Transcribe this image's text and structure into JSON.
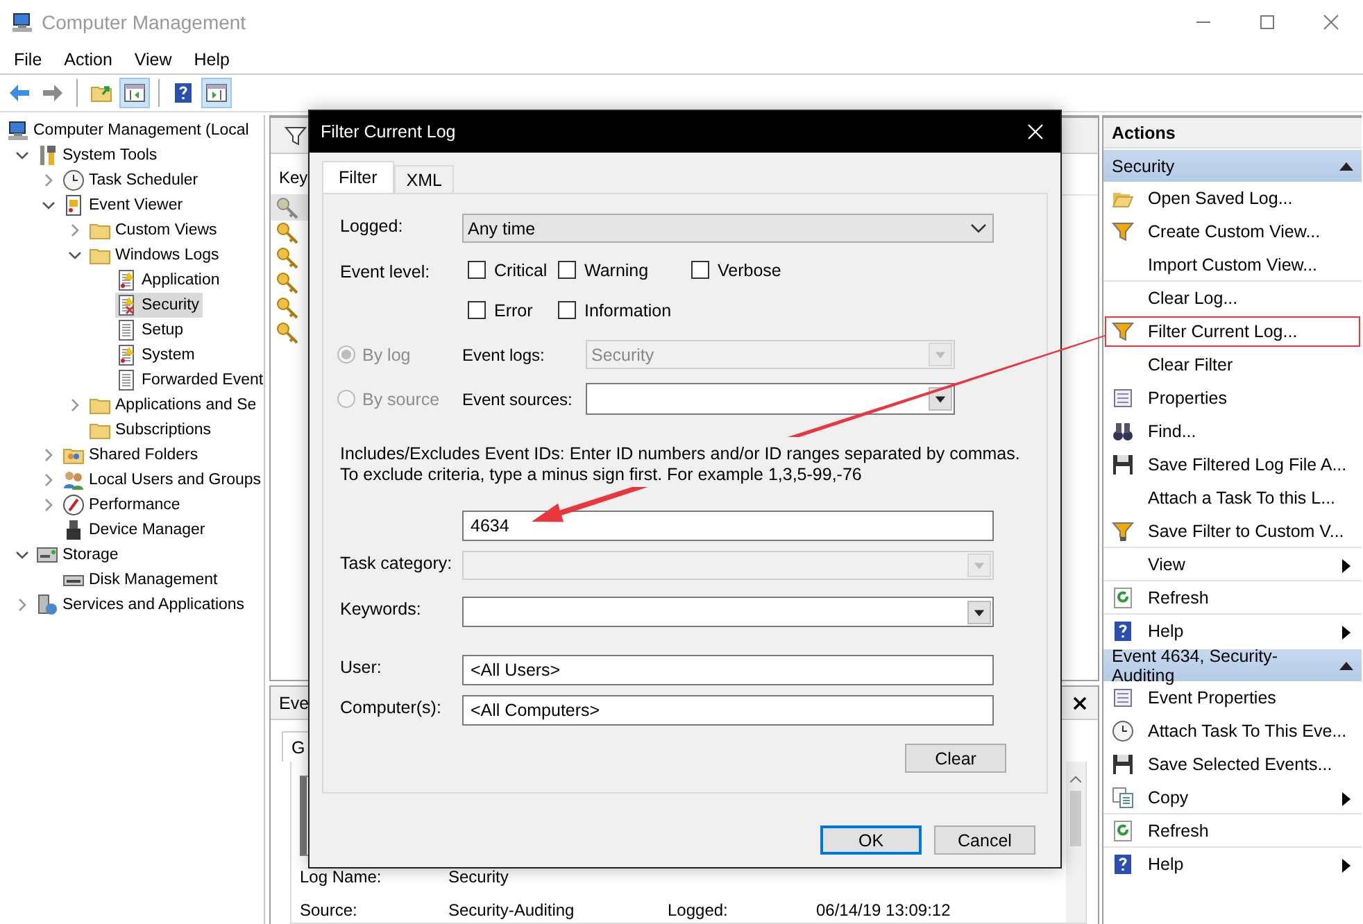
{
  "window": {
    "title": "Computer Management"
  },
  "menu": [
    "File",
    "Action",
    "View",
    "Help"
  ],
  "toolbar": [
    [
      {
        "kind": "back",
        "pressed": false
      },
      {
        "kind": "forward",
        "pressed": false
      }
    ],
    [
      {
        "kind": "up",
        "pressed": false
      },
      {
        "kind": "pane",
        "pressed": true
      }
    ],
    [
      {
        "kind": "help",
        "pressed": false
      },
      {
        "kind": "actionpane",
        "pressed": true
      }
    ]
  ],
  "tree": [
    {
      "label": "Computer Management (Local",
      "kind": "computer",
      "expandable": false,
      "selected": false,
      "children": [
        {
          "label": "System Tools",
          "kind": "tools",
          "expandable": true,
          "expanded": true,
          "selected": false,
          "children": [
            {
              "label": "Task Scheduler",
              "kind": "clock",
              "expandable": true,
              "expanded": false,
              "selected": false
            },
            {
              "label": "Event Viewer",
              "kind": "logbook",
              "expandable": true,
              "expanded": true,
              "selected": false,
              "children": [
                {
                  "label": "Custom Views",
                  "kind": "folder",
                  "expandable": true,
                  "expanded": false,
                  "selected": false
                },
                {
                  "label": "Windows Logs",
                  "kind": "folder",
                  "expandable": true,
                  "expanded": true,
                  "selected": false,
                  "children": [
                    {
                      "label": "Application",
                      "kind": "logwarn",
                      "expandable": false,
                      "selected": false
                    },
                    {
                      "label": "Security",
                      "kind": "logsec",
                      "expandable": false,
                      "selected": true
                    },
                    {
                      "label": "Setup",
                      "kind": "log",
                      "expandable": false,
                      "selected": false
                    },
                    {
                      "label": "System",
                      "kind": "logwarn",
                      "expandable": false,
                      "selected": false
                    },
                    {
                      "label": "Forwarded Event",
                      "kind": "log",
                      "expandable": false,
                      "selected": false
                    }
                  ]
                },
                {
                  "label": "Applications and Se",
                  "kind": "folder",
                  "expandable": true,
                  "expanded": false,
                  "selected": false
                },
                {
                  "label": "Subscriptions",
                  "kind": "folder",
                  "expandable": false,
                  "selected": false
                }
              ]
            },
            {
              "label": "Shared Folders",
              "kind": "share",
              "expandable": true,
              "expanded": false,
              "selected": false
            },
            {
              "label": "Local Users and Groups",
              "kind": "users",
              "expandable": true,
              "expanded": false,
              "selected": false
            },
            {
              "label": "Performance",
              "kind": "gauge",
              "expandable": true,
              "expanded": false,
              "selected": false
            },
            {
              "label": "Device Manager",
              "kind": "device",
              "expandable": false,
              "selected": false
            }
          ]
        },
        {
          "label": "Storage",
          "kind": "storage",
          "expandable": true,
          "expanded": true,
          "selected": false,
          "children": [
            {
              "label": "Disk Management",
              "kind": "drive",
              "expandable": false,
              "selected": false
            }
          ]
        },
        {
          "label": "Services and Applications",
          "kind": "services",
          "expandable": true,
          "expanded": false,
          "selected": false
        }
      ]
    }
  ],
  "log_view": {
    "column_1": "Key",
    "rows": [
      {
        "selected": true
      },
      {
        "selected": false
      },
      {
        "selected": false
      },
      {
        "selected": false
      },
      {
        "selected": false
      },
      {
        "selected": false
      }
    ]
  },
  "details_pane": {
    "title": "Eve",
    "tab": "G",
    "fields": [
      {
        "label": "Log Name:",
        "value": "Security"
      },
      {
        "label": "Source:",
        "value": "Security-Auditing",
        "label_2": "Logged:",
        "value_2": "06/14/19 13:09:12"
      }
    ]
  },
  "actions": {
    "title": "Actions",
    "sections": [
      {
        "title": "Security",
        "expanded": true,
        "items": [
          {
            "label": "Open Saved Log...",
            "kind": "openfolder",
            "submenu": false,
            "separator": false,
            "highlighted": false
          },
          {
            "label": "Create Custom View...",
            "kind": "funnel",
            "submenu": false,
            "separator": false,
            "highlighted": false
          },
          {
            "label": "Import Custom View...",
            "kind": "plain",
            "submenu": false,
            "separator": true,
            "highlighted": false
          },
          {
            "label": "Clear Log...",
            "kind": "plain",
            "submenu": false,
            "separator": false,
            "highlighted": false
          },
          {
            "label": "Filter Current Log...",
            "kind": "funnel",
            "submenu": false,
            "separator": false,
            "highlighted": true
          },
          {
            "label": "Clear Filter",
            "kind": "plain",
            "submenu": false,
            "separator": false,
            "highlighted": false
          },
          {
            "label": "Properties",
            "kind": "properties",
            "submenu": false,
            "separator": false,
            "highlighted": false
          },
          {
            "label": "Find...",
            "kind": "find",
            "submenu": false,
            "separator": false,
            "highlighted": false
          },
          {
            "label": "Save Filtered Log File A...",
            "kind": "save",
            "submenu": false,
            "separator": false,
            "highlighted": false
          },
          {
            "label": "Attach a Task To this L...",
            "kind": "plain",
            "submenu": false,
            "separator": false,
            "highlighted": false
          },
          {
            "label": "Save Filter to Custom V...",
            "kind": "funnelsave",
            "submenu": false,
            "separator": true,
            "highlighted": false
          },
          {
            "label": "View",
            "kind": "plain",
            "submenu": true,
            "separator": true,
            "highlighted": false
          },
          {
            "label": "Refresh",
            "kind": "refresh",
            "submenu": false,
            "separator": true,
            "highlighted": false
          },
          {
            "label": "Help",
            "kind": "help",
            "submenu": true,
            "separator": false,
            "highlighted": false
          }
        ]
      },
      {
        "title": "Event 4634, Security-Auditing",
        "expanded": true,
        "items": [
          {
            "label": "Event Properties",
            "kind": "properties",
            "submenu": false,
            "separator": false,
            "highlighted": false
          },
          {
            "label": "Attach Task To This Eve...",
            "kind": "clock",
            "submenu": false,
            "separator": false,
            "highlighted": false
          },
          {
            "label": "Save Selected Events...",
            "kind": "save",
            "submenu": false,
            "separator": false,
            "highlighted": false
          },
          {
            "label": "Copy",
            "kind": "copy",
            "submenu": true,
            "separator": true,
            "highlighted": false
          },
          {
            "label": "Refresh",
            "kind": "refresh",
            "submenu": false,
            "separator": true,
            "highlighted": false
          },
          {
            "label": "Help",
            "kind": "help",
            "submenu": true,
            "separator": false,
            "highlighted": false
          }
        ]
      }
    ]
  },
  "dialog": {
    "title": "Filter Current Log",
    "tabs": [
      {
        "label": "Filter",
        "selected": true
      },
      {
        "label": "XML",
        "selected": false
      }
    ],
    "logged": {
      "label": "Logged:",
      "value": "Any time"
    },
    "event_level": {
      "label": "Event level:",
      "options": [
        {
          "label": "Critical",
          "checked": false
        },
        {
          "label": "Warning",
          "checked": false
        },
        {
          "label": "Verbose",
          "checked": false
        },
        {
          "label": "Error",
          "checked": false
        },
        {
          "label": "Information",
          "checked": false
        }
      ]
    },
    "source_mode": [
      {
        "label": "By log",
        "selected": true,
        "disabled": true,
        "field_label": "Event logs:",
        "field_value": "Security",
        "field_disabled": true
      },
      {
        "label": "By source",
        "selected": false,
        "disabled": true,
        "field_label": "Event sources:",
        "field_disabled": false
      }
    ],
    "event_ids": {
      "description": "Includes/Excludes Event IDs: Enter ID numbers and/or ID ranges separated by commas. To exclude criteria, type a minus sign first. For example 1,3,5-99,-76",
      "value": "4634"
    },
    "task_category": {
      "label": "Task category:",
      "disabled": true
    },
    "keywords": {
      "label": "Keywords:",
      "disabled": false
    },
    "user": {
      "label": "User:",
      "value": "<All Users>"
    },
    "computers": {
      "label": "Computer(s):",
      "value": "<All Computers>"
    },
    "clear_button": "Clear",
    "buttons": [
      {
        "label": "OK",
        "default": true
      },
      {
        "label": "Cancel",
        "default": false
      }
    ]
  }
}
